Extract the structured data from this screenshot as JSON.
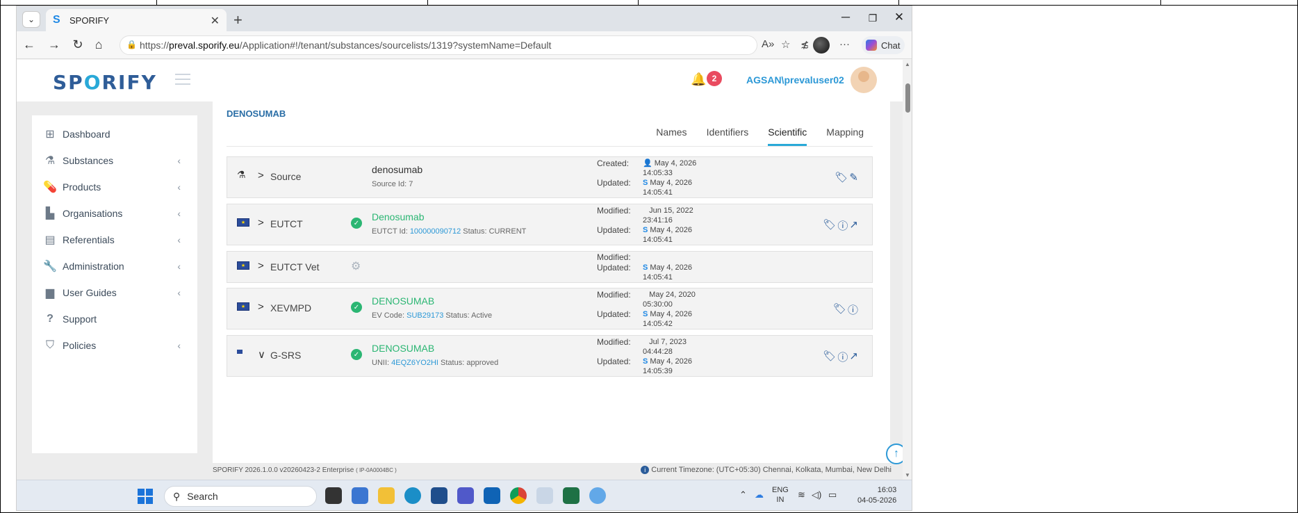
{
  "browser": {
    "tab_title": "SPORIFY",
    "url_prefix": "https://",
    "url_domain": "preval.sporify.eu",
    "url_path": "/Application#!/tenant/substances/sourcelists/1319?systemName=Default",
    "chat_label": "Chat"
  },
  "header": {
    "logo": "SPORIFY",
    "notification_count": "2",
    "user_name": "AGSAN\\prevaluser02"
  },
  "sidebar": {
    "items": [
      {
        "label": "Dashboard",
        "icon": "grid-icon",
        "has_chevron": false
      },
      {
        "label": "Substances",
        "icon": "flask-icon",
        "has_chevron": true
      },
      {
        "label": "Products",
        "icon": "pills-icon",
        "has_chevron": true
      },
      {
        "label": "Organisations",
        "icon": "industry-icon",
        "has_chevron": true
      },
      {
        "label": "Referentials",
        "icon": "list-icon",
        "has_chevron": true
      },
      {
        "label": "Administration",
        "icon": "wrench-icon",
        "has_chevron": true
      },
      {
        "label": "User Guides",
        "icon": "book-icon",
        "has_chevron": true
      },
      {
        "label": "Support",
        "icon": "question-icon",
        "has_chevron": false
      },
      {
        "label": "Policies",
        "icon": "shield-icon",
        "has_chevron": true
      }
    ]
  },
  "substance": {
    "title": "DENOSUMAB",
    "tabs": [
      "Names",
      "Identifiers",
      "Scientific",
      "Mapping"
    ],
    "active_tab": "Scientific"
  },
  "cards": [
    {
      "source": "Source",
      "caret": ">",
      "name": "denosumab",
      "name_green": false,
      "sub_prefix": "Source Id: 7",
      "sub_link": "",
      "sub_suffix": "",
      "k1": "Created:",
      "v1a": "May 4, 2026",
      "v1b": "14:05:33",
      "k2": "Updated:",
      "v2a": "May 4, 2026",
      "v2b": "14:05:41"
    },
    {
      "source": "EUTCT",
      "caret": ">",
      "name": "Denosumab",
      "name_green": true,
      "sub_prefix": "EUTCT Id: ",
      "sub_link": "100000090712",
      "sub_suffix": "  Status: CURRENT",
      "k1": "Modified:",
      "v1a": "Jun 15, 2022",
      "v1b": "23:41:16",
      "k2": "Updated:",
      "v2a": "May 4, 2026",
      "v2b": "14:05:41"
    },
    {
      "source": "EUTCT Vet",
      "caret": ">",
      "name": "",
      "name_green": false,
      "sub_prefix": "",
      "sub_link": "",
      "sub_suffix": "",
      "k1": "Modified:",
      "v1a": "",
      "v1b": "",
      "k2": "Updated:",
      "v2a": "May 4, 2026",
      "v2b": "14:05:41"
    },
    {
      "source": "XEVMPD",
      "caret": ">",
      "name": "DENOSUMAB",
      "name_green": true,
      "sub_prefix": "EV Code: ",
      "sub_link": "SUB29173",
      "sub_suffix": "  Status: Active",
      "k1": "Modified:",
      "v1a": "May 24, 2020",
      "v1b": "05:30:00",
      "k2": "Updated:",
      "v2a": "May 4, 2026",
      "v2b": "14:05:42"
    },
    {
      "source": "G-SRS",
      "caret": "∨",
      "name": "DENOSUMAB",
      "name_green": true,
      "sub_prefix": "UNII: ",
      "sub_link": "4EQZ6YO2HI",
      "sub_suffix": "  Status: approved",
      "k1": "Modified:",
      "v1a": "Jul 7, 2023",
      "v1b": "04:44:28",
      "k2": "Updated:",
      "v2a": "May 4, 2026",
      "v2b": "14:05:39"
    }
  ],
  "footer": {
    "version": "SPORIFY 2026.1.0.0 v20260423-2 Enterprise",
    "build": "( IP-0A0004BC )",
    "timezone": "Current Timezone: (UTC+05:30) Chennai, Kolkata, Mumbai, New Delhi"
  },
  "taskbar": {
    "search_label": "Search",
    "lang": "ENG",
    "region": "IN",
    "time": "16:03",
    "date": "04-05-2026"
  }
}
